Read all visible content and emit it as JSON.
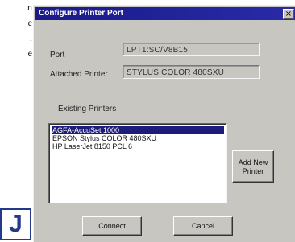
{
  "document_text": {
    "lines": [
      "n",
      "e",
      ".",
      "e"
    ]
  },
  "dialog": {
    "title": "Configure Printer Port",
    "close_glyph": "×",
    "port_label": "Port",
    "port_value": "LPT1:SC/V8B15",
    "attached_printer_label": "Attached Printer",
    "attached_printer_value": "STYLUS COLOR 480SXU",
    "existing_printers_label": "Existing Printers",
    "printers": [
      {
        "name": "AGFA-AccuSet 1000",
        "selected": true
      },
      {
        "name": "EPSON Stylus COLOR 480SXU",
        "selected": false
      },
      {
        "name": "HP LaserJet 8150 PCL 6",
        "selected": false
      }
    ],
    "add_new_printer_label": [
      "Add New",
      "Printer"
    ],
    "connect_label": "Connect",
    "cancel_label": "Cancel"
  },
  "badge": {
    "letter": "J"
  },
  "colors": {
    "titlebar": "#1a1a8a",
    "dialog_face": "#c8c6c0",
    "selection": "#1c1c7a",
    "badge": "#233a8a"
  }
}
